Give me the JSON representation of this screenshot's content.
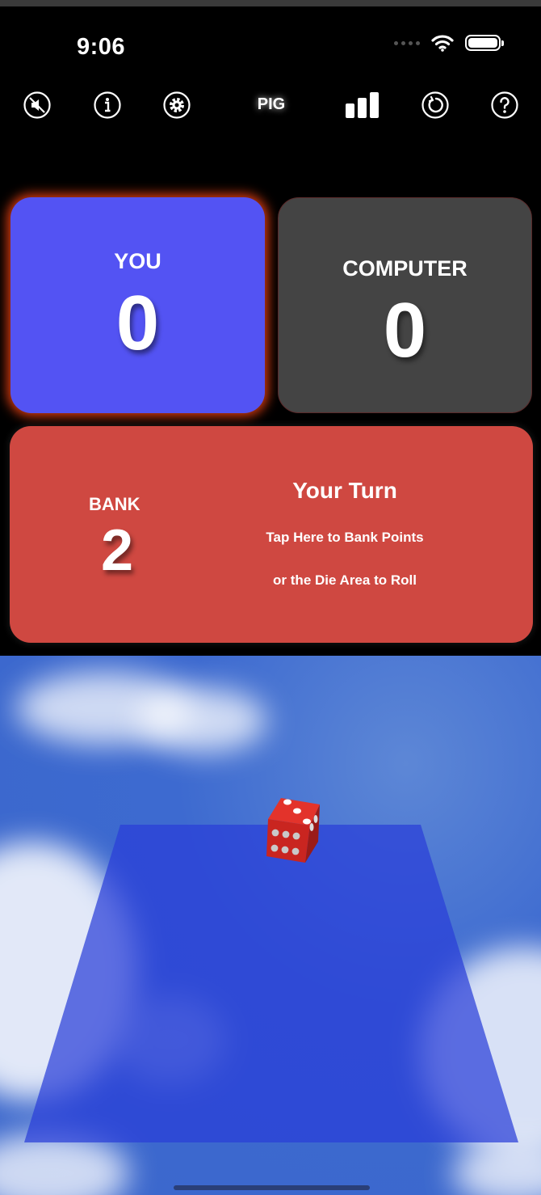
{
  "status_bar": {
    "time": "9:06"
  },
  "toolbar": {
    "title": "PIG",
    "icons": [
      "mute-icon",
      "info-icon",
      "settings-icon",
      "stats-icon",
      "restart-icon",
      "help-icon"
    ]
  },
  "players": {
    "you": {
      "label": "YOU",
      "score": "0"
    },
    "computer": {
      "label": "COMPUTER",
      "score": "0"
    }
  },
  "bank": {
    "label": "BANK",
    "value": "2",
    "turn_title": "Your Turn",
    "instruction_1": "Tap Here to Bank Points",
    "instruction_2": "or the Die Area to Roll"
  },
  "die": {
    "top_face": 3,
    "front_face": 6,
    "color": "#d9241f"
  },
  "colors": {
    "you_card": "#5353f3",
    "computer_card": "#444444",
    "bank_card": "#cf4841",
    "active_glow": "#ff4614",
    "table": "#2a3fd8"
  }
}
